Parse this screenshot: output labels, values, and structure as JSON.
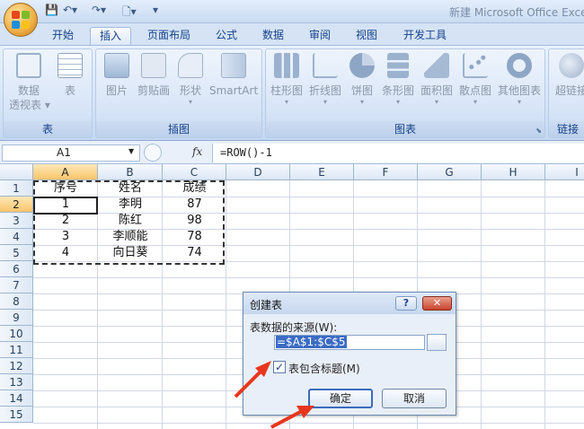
{
  "window": {
    "title": "新建 Microsoft Office Exce"
  },
  "quick_access": {
    "save_icon": "save-icon",
    "undo_icon": "undo-icon",
    "redo_icon": "redo-icon",
    "preview_icon": "print-preview-icon",
    "customize": "▾"
  },
  "tabs": [
    "开始",
    "插入",
    "页面布局",
    "公式",
    "数据",
    "审阅",
    "视图",
    "开发工具"
  ],
  "active_tab": "插入",
  "ribbon": {
    "groups": [
      {
        "label": "表",
        "buttons": [
          {
            "label": "数据\n透视表",
            "arrow": "▾"
          },
          {
            "label": "表"
          }
        ]
      },
      {
        "label": "插图",
        "buttons": [
          {
            "label": "图片"
          },
          {
            "label": "剪贴画"
          },
          {
            "label": "形状"
          },
          {
            "label": "SmartArt"
          }
        ]
      },
      {
        "label": "图表",
        "buttons": [
          {
            "label": "柱形图"
          },
          {
            "label": "折线图"
          },
          {
            "label": "饼图"
          },
          {
            "label": "条形图"
          },
          {
            "label": "面积图"
          },
          {
            "label": "散点图"
          },
          {
            "label": "其他图表"
          }
        ]
      },
      {
        "label": "链接",
        "buttons": [
          {
            "label": "超链接"
          }
        ]
      }
    ]
  },
  "formula_bar": {
    "name_box": "A1",
    "fx": "fx",
    "formula": "=ROW()-1"
  },
  "grid": {
    "columns": [
      "A",
      "B",
      "C",
      "D",
      "E",
      "F",
      "G",
      "H",
      "I"
    ],
    "rows": [
      "1",
      "2",
      "3",
      "4",
      "5",
      "6",
      "7",
      "8",
      "9",
      "10",
      "11",
      "12",
      "13",
      "14",
      "15"
    ],
    "data": [
      [
        "序号",
        "姓名",
        "成绩"
      ],
      [
        "1",
        "李明",
        "87"
      ],
      [
        "2",
        "陈红",
        "98"
      ],
      [
        "3",
        "李顺能",
        "78"
      ],
      [
        "4",
        "向日葵",
        "74"
      ]
    ]
  },
  "dialog": {
    "title": "创建表",
    "help": "?",
    "close": "✕",
    "source_label": "表数据的来源(W):",
    "range": "=$A$1:$C$5",
    "has_headers_label": "表包含标题(M)",
    "has_headers_checked": "✓",
    "ok": "确定",
    "cancel": "取消"
  },
  "colors": {
    "accent_arrow": "#e8361e",
    "selection": "#f8c46b"
  }
}
